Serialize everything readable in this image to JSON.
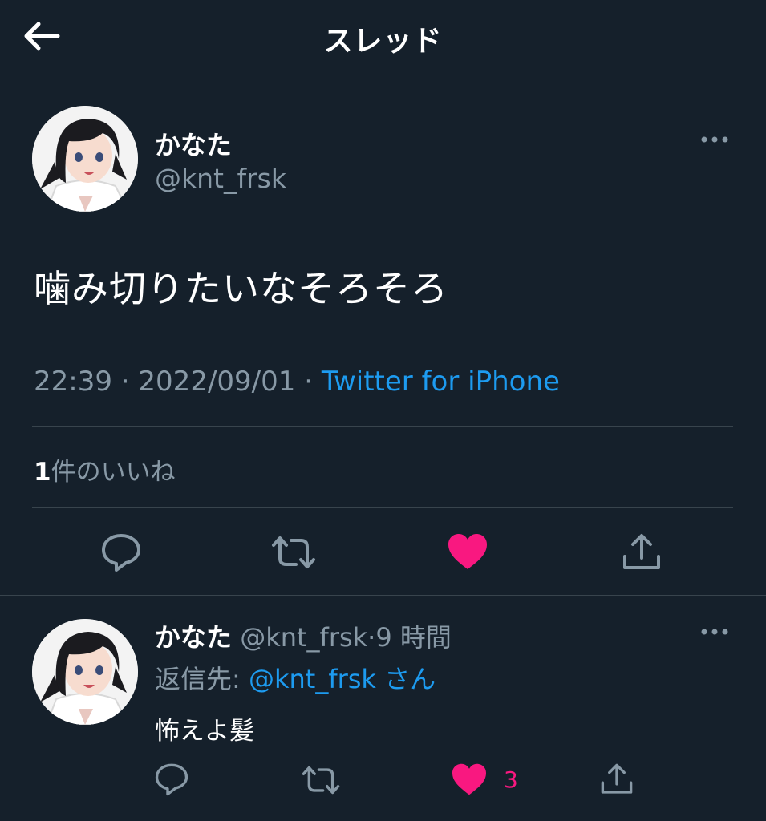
{
  "header": {
    "title": "スレッド",
    "back_icon": "arrow-left-icon"
  },
  "main_tweet": {
    "display_name": "かなた",
    "handle": "@knt_frsk",
    "text": "噛み切りたいなそろそろ",
    "time": "22:39",
    "sep1": "·",
    "date": "2022/09/01",
    "sep2": "·",
    "source": "Twitter for iPhone",
    "likes_count": "1",
    "likes_label": "件のいいね",
    "liked": true
  },
  "reply": {
    "display_name": "かなた",
    "handle": "@knt_frsk",
    "sep": "·",
    "time": "9 時間",
    "reply_to_label": "返信先:",
    "reply_to_handle": "@knt_frsk",
    "reply_to_suffix": "さん",
    "text": "怖えよ髪",
    "like_count": "3",
    "liked": true
  },
  "colors": {
    "background": "#15202b",
    "text": "#ffffff",
    "muted": "#8899a6",
    "link": "#1d9bf0",
    "like": "#f91880",
    "divider": "#38444d"
  },
  "icons": [
    "arrow-left-icon",
    "more-icon",
    "reply-icon",
    "retweet-icon",
    "heart-icon",
    "share-icon"
  ]
}
